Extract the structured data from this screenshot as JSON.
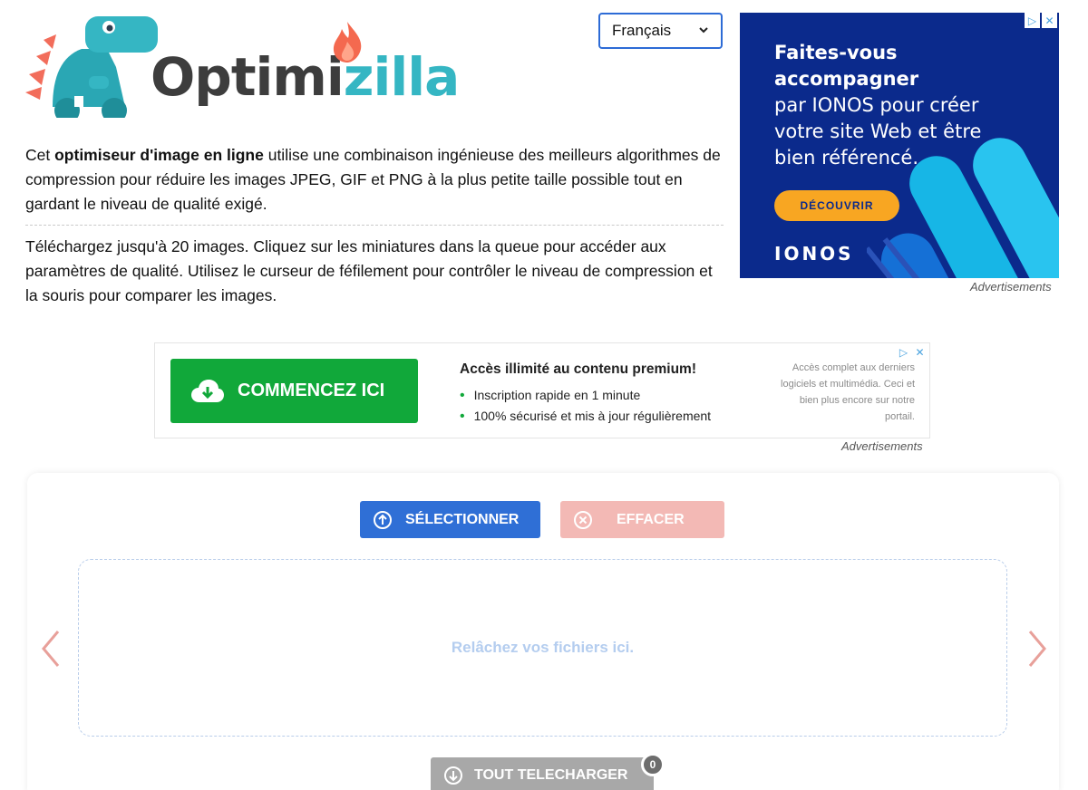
{
  "logo": {
    "word_part1": "Optimi",
    "word_part2": "zilla"
  },
  "language": {
    "selected": "Français"
  },
  "intro": {
    "p1_pre": "Cet ",
    "p1_bold": "optimiseur d'image en ligne",
    "p1_post": " utilise une combinaison ingénieuse des meilleurs algorithmes de compression pour réduire les images JPEG, GIF et PNG à la plus petite taille possible tout en gardant le niveau de qualité exigé.",
    "p2": "Téléchargez jusqu'à 20 images. Cliquez sur les miniatures dans la queue pour accéder aux paramètres de qualité. Utilisez le curseur de féfilement pour contrôler le niveau de compression et la souris pour comparer les images."
  },
  "ad1": {
    "line1": "Faites-vous",
    "line2": "accompagner",
    "line3": "par IONOS pour créer",
    "line4": "votre site Web et être",
    "line5": "bien référencé.",
    "button": "DÉCOUVRIR",
    "brand": "IONOS",
    "label": "Advertisements"
  },
  "ad2": {
    "button": "COMMENCEZ ICI",
    "title": "Accès illimité au contenu premium!",
    "bullets": [
      "Inscription rapide en 1 minute",
      "100% sécurisé et mis à jour régulièrement"
    ],
    "side": "Accès complet aux derniers logiciels et multimédia. Ceci et bien plus encore sur notre portail.",
    "label": "Advertisements"
  },
  "upload": {
    "select": "SÉLECTIONNER",
    "clear": "EFFACER",
    "drop_text": "Relâchez vos fichiers ici.",
    "download_all": "TOUT TELECHARGER",
    "count": "0"
  },
  "colors": {
    "primary": "#2f6fd6",
    "logo_teal": "#35b6c3",
    "ad_blue": "#0b2a8c",
    "ad_orange": "#f8a622",
    "ad_green": "#11a83a",
    "clear_pink": "#f3b9b5",
    "arrow_pink": "#e8a09a"
  }
}
